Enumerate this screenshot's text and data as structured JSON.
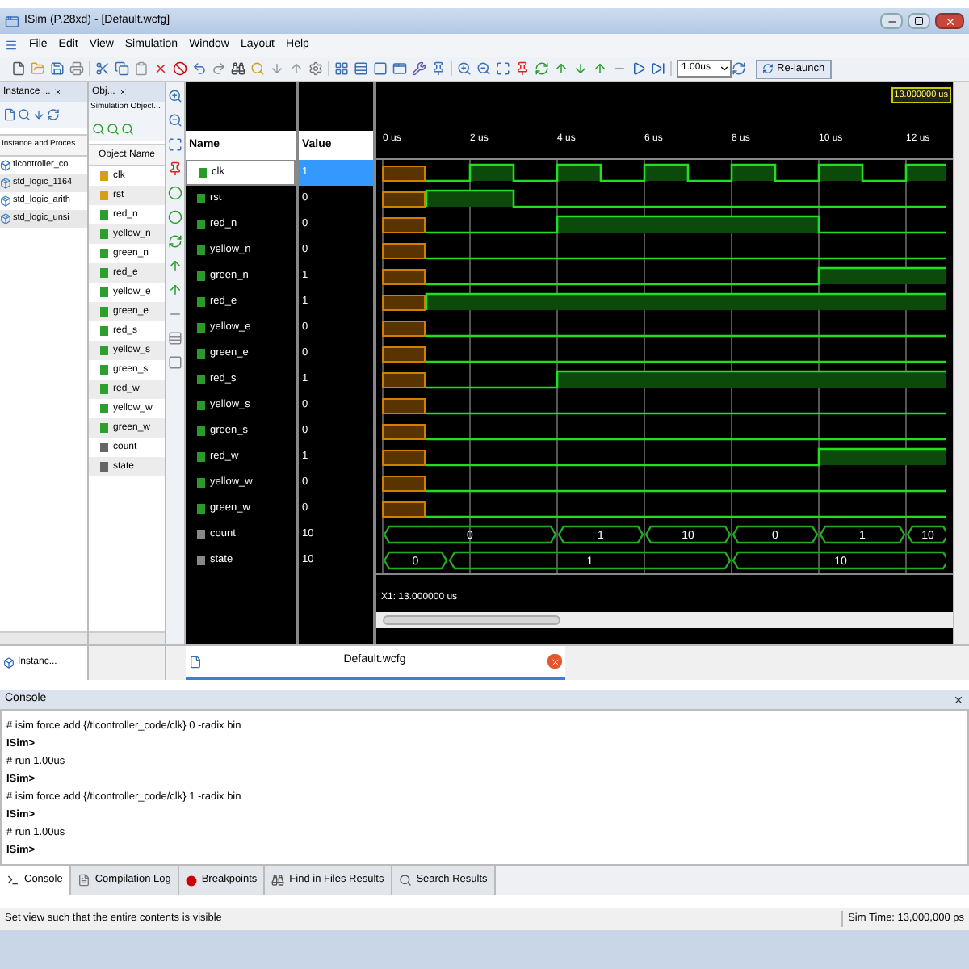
{
  "window": {
    "title": "ISim (P.28xd) - [Default.wcfg]"
  },
  "menu": [
    "File",
    "Edit",
    "View",
    "Simulation",
    "Window",
    "Layout",
    "Help"
  ],
  "toolbar": {
    "run_time": "1.00us",
    "relaunch": "Re-launch"
  },
  "instances_panel": {
    "title": "Instance ...",
    "column": "Instance and Proces",
    "tab": "Instanc...",
    "items": [
      {
        "label": "tlcontroller_co",
        "kind": "module"
      },
      {
        "label": "std_logic_1164",
        "kind": "package"
      },
      {
        "label": "std_logic_arith",
        "kind": "package"
      },
      {
        "label": "std_logic_unsi",
        "kind": "package"
      }
    ]
  },
  "objects_panel": {
    "title": "Obj...",
    "subtitle": "Simulation Object...",
    "column": "Object Name",
    "items": [
      {
        "label": "clk",
        "kind": "input"
      },
      {
        "label": "rst",
        "kind": "input"
      },
      {
        "label": "red_n",
        "kind": "output"
      },
      {
        "label": "yellow_n",
        "kind": "output"
      },
      {
        "label": "green_n",
        "kind": "output"
      },
      {
        "label": "red_e",
        "kind": "output"
      },
      {
        "label": "yellow_e",
        "kind": "output"
      },
      {
        "label": "green_e",
        "kind": "output"
      },
      {
        "label": "red_s",
        "kind": "output"
      },
      {
        "label": "yellow_s",
        "kind": "output"
      },
      {
        "label": "green_s",
        "kind": "output"
      },
      {
        "label": "red_w",
        "kind": "output"
      },
      {
        "label": "yellow_w",
        "kind": "output"
      },
      {
        "label": "green_w",
        "kind": "output"
      },
      {
        "label": "count",
        "kind": "signal"
      },
      {
        "label": "state",
        "kind": "signal"
      }
    ]
  },
  "wave": {
    "cursor": "13.000000 us",
    "name_header": "Name",
    "value_header": "Value",
    "marker": "X1: 13.000000 us",
    "ticks": [
      "0 us",
      "2 us",
      "4 us",
      "6 us",
      "8 us",
      "10 us",
      "12 us"
    ],
    "signals": [
      {
        "name": "clk",
        "value": "1",
        "kind": "bit",
        "selected": true
      },
      {
        "name": "rst",
        "value": "0",
        "kind": "bit",
        "selected": false
      },
      {
        "name": "red_n",
        "value": "0",
        "kind": "bit",
        "selected": false
      },
      {
        "name": "yellow_n",
        "value": "0",
        "kind": "bit",
        "selected": false
      },
      {
        "name": "green_n",
        "value": "1",
        "kind": "bit",
        "selected": false
      },
      {
        "name": "red_e",
        "value": "1",
        "kind": "bit",
        "selected": false
      },
      {
        "name": "yellow_e",
        "value": "0",
        "kind": "bit",
        "selected": false
      },
      {
        "name": "green_e",
        "value": "0",
        "kind": "bit",
        "selected": false
      },
      {
        "name": "red_s",
        "value": "1",
        "kind": "bit",
        "selected": false
      },
      {
        "name": "yellow_s",
        "value": "0",
        "kind": "bit",
        "selected": false
      },
      {
        "name": "green_s",
        "value": "0",
        "kind": "bit",
        "selected": false
      },
      {
        "name": "red_w",
        "value": "1",
        "kind": "bit",
        "selected": false
      },
      {
        "name": "yellow_w",
        "value": "0",
        "kind": "bit",
        "selected": false
      },
      {
        "name": "green_w",
        "value": "0",
        "kind": "bit",
        "selected": false
      },
      {
        "name": "count",
        "value": "10",
        "kind": "bus",
        "selected": false,
        "segments": [
          "0",
          "1",
          "10",
          "0",
          "1",
          "10"
        ]
      },
      {
        "name": "state",
        "value": "10",
        "kind": "bus",
        "selected": false,
        "segments": [
          "0",
          "1",
          "10"
        ]
      }
    ]
  },
  "document_tab": {
    "label": "Default.wcfg"
  },
  "console": {
    "title": "Console",
    "lines": [
      {
        "text": "# isim force add {/tlcontroller_code/clk} 0 -radix bin",
        "kind": "command"
      },
      {
        "text": "ISim>",
        "kind": "prompt"
      },
      {
        "text": "# run 1.00us",
        "kind": "command"
      },
      {
        "text": "ISim>",
        "kind": "prompt"
      },
      {
        "text": "# isim force add {/tlcontroller_code/clk} 1 -radix bin",
        "kind": "command"
      },
      {
        "text": "ISim>",
        "kind": "prompt"
      },
      {
        "text": "# run 1.00us",
        "kind": "command"
      },
      {
        "text": "ISim>",
        "kind": "prompt"
      }
    ]
  },
  "bottom_tabs": [
    {
      "label": "Console",
      "selected": true
    },
    {
      "label": "Compilation Log",
      "selected": false
    },
    {
      "label": "Breakpoints",
      "selected": false
    },
    {
      "label": "Find in Files Results",
      "selected": false
    },
    {
      "label": "Search Results",
      "selected": false
    }
  ],
  "status_bar": {
    "message": "Set view such that the entire contents is visible",
    "sim_time": "Sim Time: 13,000,000 ps"
  }
}
